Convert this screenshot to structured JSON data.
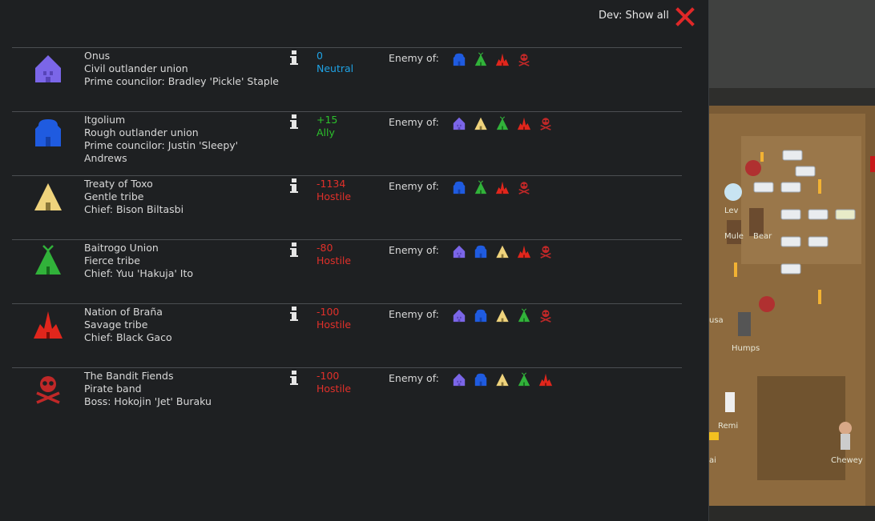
{
  "header": {
    "dev_show_all": "Dev: Show all",
    "close_icon": "close-x-icon"
  },
  "enemy_label": "Enemy of:",
  "colors": {
    "neutral": "#1fa2e4",
    "ally": "#2cc12c",
    "hostile": "#e0302a",
    "text": "#d8d8d8"
  },
  "factions": [
    {
      "name": "Onus",
      "type": "Civil outlander union",
      "leader": "Prime councilor: Bradley 'Pickle' Staple",
      "leader_cont": "",
      "goodwill": "0",
      "relation": "Neutral",
      "relation_color": "#1fa2e4",
      "icon": "outlander-civil-icon",
      "enemies": [
        "outlander-rough-icon",
        "tribe-fierce-icon",
        "tribe-savage-icon",
        "pirate-icon"
      ]
    },
    {
      "name": "Itgolium",
      "type": "Rough outlander union",
      "leader": "Prime councilor: Justin 'Sleepy'",
      "leader_cont": "Andrews",
      "goodwill": "+15",
      "relation": "Ally",
      "relation_color": "#2cc12c",
      "icon": "outlander-rough-icon",
      "enemies": [
        "outlander-civil-icon",
        "tribe-gentle-icon",
        "tribe-fierce-icon",
        "tribe-savage-icon",
        "pirate-icon"
      ]
    },
    {
      "name": "Treaty of Toxo",
      "type": "Gentle tribe",
      "leader": "Chief: Bison Biltasbi",
      "leader_cont": "",
      "goodwill": "-1134",
      "relation": "Hostile",
      "relation_color": "#e0302a",
      "icon": "tribe-gentle-icon",
      "enemies": [
        "outlander-rough-icon",
        "tribe-fierce-icon",
        "tribe-savage-icon",
        "pirate-icon"
      ]
    },
    {
      "name": "Baitrogo Union",
      "type": "Fierce tribe",
      "leader": "Chief: Yuu 'Hakuja' Ito",
      "leader_cont": "",
      "goodwill": "-80",
      "relation": "Hostile",
      "relation_color": "#e0302a",
      "icon": "tribe-fierce-icon",
      "enemies": [
        "outlander-civil-icon",
        "outlander-rough-icon",
        "tribe-gentle-icon",
        "tribe-savage-icon",
        "pirate-icon"
      ]
    },
    {
      "name": "Nation of Braña",
      "type": "Savage tribe",
      "leader": "Chief: Black Gaco",
      "leader_cont": "",
      "goodwill": "-100",
      "relation": "Hostile",
      "relation_color": "#e0302a",
      "icon": "tribe-savage-icon",
      "enemies": [
        "outlander-civil-icon",
        "outlander-rough-icon",
        "tribe-gentle-icon",
        "tribe-fierce-icon",
        "pirate-icon"
      ]
    },
    {
      "name": "The Bandit Fiends",
      "type": "Pirate band",
      "leader": "Boss: Hokojin 'Jet' Buraku",
      "leader_cont": "",
      "goodwill": "-100",
      "relation": "Hostile",
      "relation_color": "#e0302a",
      "icon": "pirate-icon",
      "enemies": [
        "outlander-civil-icon",
        "outlander-rough-icon",
        "tribe-gentle-icon",
        "tribe-fierce-icon",
        "tribe-savage-icon"
      ]
    }
  ],
  "map": {
    "pawns": [
      "Lev",
      "Mule",
      "Bear",
      "usa",
      "Humps",
      "Remi",
      "ai",
      "Chewey"
    ]
  }
}
